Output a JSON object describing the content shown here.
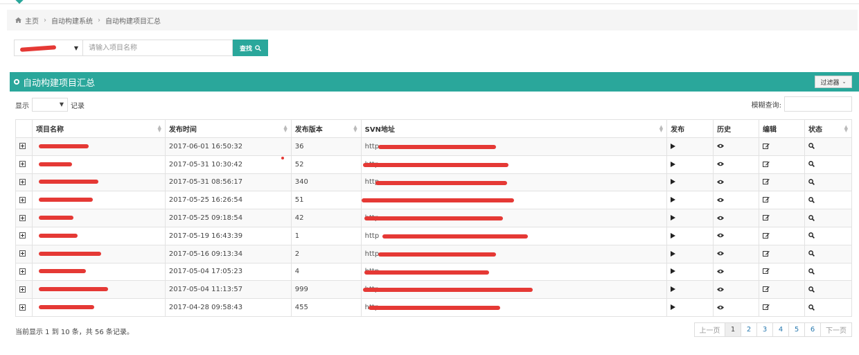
{
  "breadcrumb": {
    "home": "主页",
    "items": [
      "自动构建系统",
      "自动构建项目汇总"
    ]
  },
  "search": {
    "placeholder": "请输入项目名称",
    "button_label": "查找"
  },
  "panel": {
    "title": "自动构建项目汇总",
    "filter_label": "过滤器"
  },
  "length_control": {
    "prefix": "显示",
    "suffix": "记录"
  },
  "fuzzy_search": {
    "label": "模糊查询:"
  },
  "table": {
    "columns": [
      "项目名称",
      "发布时间",
      "发布版本",
      "SVN地址",
      "发布",
      "历史",
      "编辑",
      "状态"
    ],
    "rows": [
      {
        "time": "2017-06-01 16:50:32",
        "version": "36",
        "svn_prefix": "http"
      },
      {
        "time": "2017-05-31 10:30:42",
        "version": "52",
        "svn_prefix": "http"
      },
      {
        "time": "2017-05-31 08:56:17",
        "version": "340",
        "svn_prefix": "http"
      },
      {
        "time": "2017-05-25 16:26:54",
        "version": "51",
        "svn_prefix": ""
      },
      {
        "time": "2017-05-25 09:18:54",
        "version": "42",
        "svn_prefix": "http"
      },
      {
        "time": "2017-05-19 16:43:39",
        "version": "1",
        "svn_prefix": "http"
      },
      {
        "time": "2017-05-16 09:13:34",
        "version": "2",
        "svn_prefix": "http"
      },
      {
        "time": "2017-05-04 17:05:23",
        "version": "4",
        "svn_prefix": "http"
      },
      {
        "time": "2017-05-04 11:13:57",
        "version": "999",
        "svn_prefix": "http"
      },
      {
        "time": "2017-04-28 09:58:43",
        "version": "455",
        "svn_prefix": "http"
      }
    ]
  },
  "footer": {
    "info": "当前显示 1 到 10 条，共 56 条记录。"
  },
  "pagination": {
    "prev": "上一页",
    "pages": [
      "1",
      "2",
      "3",
      "4",
      "5",
      "6"
    ],
    "next": "下一页",
    "active": "1"
  },
  "colors": {
    "accent": "#2aa79b",
    "redaction": "#e53935"
  },
  "icons": {
    "home": "home-icon",
    "search": "search-icon",
    "play": "play-icon",
    "history": "eye-icon",
    "edit": "edit-icon",
    "status": "magnifier-icon",
    "expand": "plus-square-icon"
  }
}
